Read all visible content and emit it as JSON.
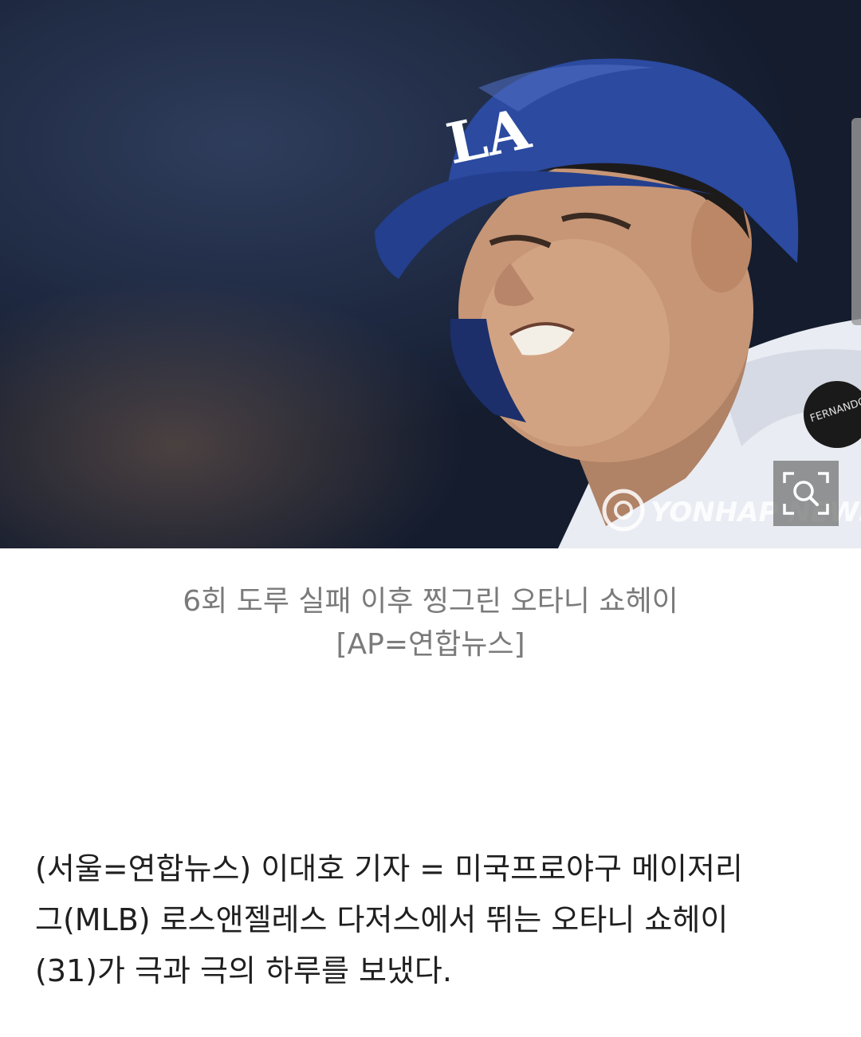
{
  "image": {
    "watermark": "YONHAP NEWS",
    "helmet_logo": "LA",
    "jersey_patch": "FERNANDO"
  },
  "zoom_button": {
    "icon": "zoom-search-icon"
  },
  "caption": {
    "line1": "6회 도루 실패 이후 찡그린 오타니 쇼헤이",
    "line2": "[AP=연합뉴스]"
  },
  "article": {
    "lines": [
      "(서울=연합뉴스) 이대호 기자 = 미국프로야구 메이저리",
      "그(MLB) 로스앤젤레스 다저스에서 뛰는 오타니 쇼헤이",
      "(31)가 극과 극의 하루를 보냈다."
    ]
  },
  "colors": {
    "caption": "#7a7a7a",
    "body_text": "#1f1f1f",
    "helmet": "#2b4aa0"
  }
}
